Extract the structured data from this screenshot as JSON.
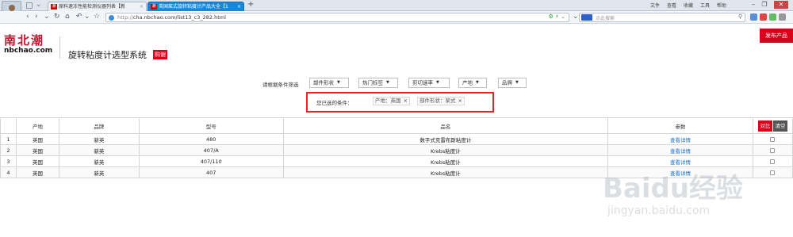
{
  "browser": {
    "tabs": [
      {
        "favicon": "潮",
        "title": "原料速冻性能检测仪器列表【新",
        "close": "×"
      },
      {
        "favicon": "潮",
        "title": "英国桨式旋转粘度计产品大全【1",
        "close": "×"
      }
    ],
    "new_tab": "+",
    "menu": [
      "文件",
      "查看",
      "收藏",
      "工具",
      "帮助"
    ],
    "window_buttons": [
      "–",
      "❐",
      "✕"
    ],
    "address": {
      "prefix": "http://",
      "url": "cha.nbchao.com/list13_c3_282.html"
    },
    "search_placeholder": "点此搜索",
    "colors": {
      "active_tab": "#1a87d6",
      "brand_red": "#d9001b"
    }
  },
  "header": {
    "logo_cn": "南北潮",
    "logo_en": "nbchao.com",
    "system_title": "旋转粘度计选型系统",
    "badge": "购谢",
    "publish_button": "发布产品"
  },
  "filters": {
    "label": "请根据条件筛选",
    "dropdowns": [
      "部件形状",
      "热门标签",
      "剪切速率",
      "产地",
      "品牌"
    ],
    "selected_label": "您已选的条件：",
    "selected": [
      {
        "text": "产地：英国",
        "remove": "×"
      },
      {
        "text": "部件形状：桨式",
        "remove": "×"
      }
    ]
  },
  "table": {
    "headers": [
      "",
      "产地",
      "品牌",
      "型号",
      "品名",
      "参数"
    ],
    "compare_button": "对比",
    "clear_button": "清空",
    "rows": [
      {
        "idx": "1",
        "origin": "英国",
        "brand": "新英",
        "model": "480",
        "name": "数字式克雷布斯粘度计",
        "param": "查看详情"
      },
      {
        "idx": "2",
        "origin": "英国",
        "brand": "新英",
        "model": "407/A",
        "name": "Krebs粘度计",
        "param": "查看详情"
      },
      {
        "idx": "3",
        "origin": "英国",
        "brand": "新英",
        "model": "407/110",
        "name": "Krebs粘度计",
        "param": "查看详情"
      },
      {
        "idx": "4",
        "origin": "英国",
        "brand": "新英",
        "model": "407",
        "name": "Krebs粘度计",
        "param": "查看详情"
      }
    ]
  },
  "watermark": {
    "big": "Baidu经验",
    "small": "jingyan.baidu.com"
  }
}
